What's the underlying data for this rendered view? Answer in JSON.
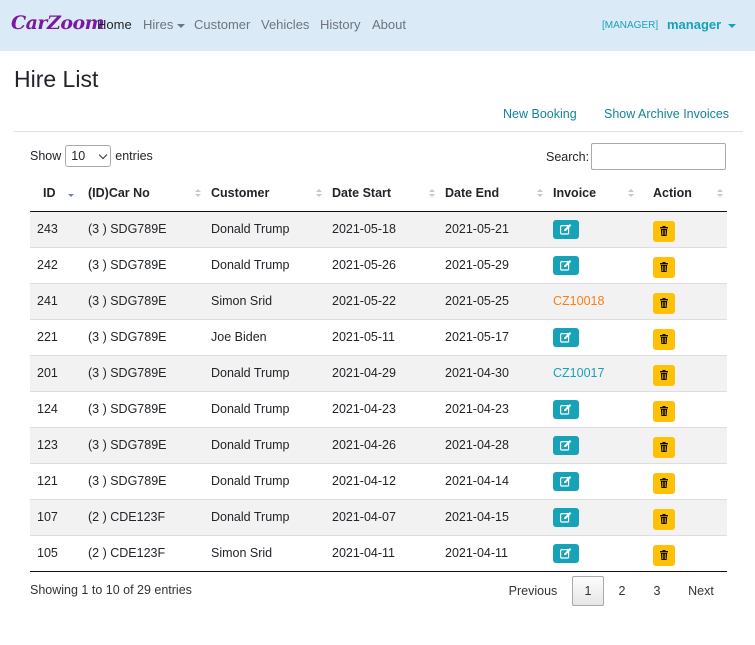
{
  "nav": {
    "brand": "CarZoom",
    "links": [
      {
        "label": "Home",
        "active": true
      },
      {
        "label": "Hires",
        "dropdown": true
      },
      {
        "label": "Customer"
      },
      {
        "label": "Vehicles"
      },
      {
        "label": "History"
      },
      {
        "label": "About"
      }
    ],
    "role": "[MANAGER]",
    "user": "manager"
  },
  "page": {
    "title": "Hire List",
    "new_booking": "New Booking",
    "show_archive": "Show Archive Invoices"
  },
  "controls": {
    "show_label": "Show",
    "entries_value": "10",
    "entries_label": "entries",
    "search_label": "Search:",
    "search_value": ""
  },
  "table": {
    "columns": [
      "ID",
      "(ID)Car No",
      "Customer",
      "Date Start",
      "Date End",
      "Invoice",
      "Action"
    ],
    "sorted_column": "ID",
    "sort_direction": "desc",
    "rows": [
      {
        "id": "243",
        "car": "(3 ) SDG789E",
        "customer": "Donald Trump",
        "start": "2021-05-18",
        "end": "2021-05-21",
        "invoice": {
          "type": "edit-button"
        }
      },
      {
        "id": "242",
        "car": "(3 ) SDG789E",
        "customer": "Donald Trump",
        "start": "2021-05-26",
        "end": "2021-05-29",
        "invoice": {
          "type": "edit-button"
        }
      },
      {
        "id": "241",
        "car": "(3 ) SDG789E",
        "customer": "Simon Srid",
        "start": "2021-05-22",
        "end": "2021-05-25",
        "invoice": {
          "type": "link",
          "text": "CZ10018",
          "color": "#fd7e14"
        }
      },
      {
        "id": "221",
        "car": "(3 ) SDG789E",
        "customer": "Joe Biden",
        "start": "2021-05-11",
        "end": "2021-05-17",
        "invoice": {
          "type": "edit-button"
        }
      },
      {
        "id": "201",
        "car": "(3 ) SDG789E",
        "customer": "Donald Trump",
        "start": "2021-04-29",
        "end": "2021-04-30",
        "invoice": {
          "type": "link",
          "text": "CZ10017",
          "color": "#17a2b8"
        }
      },
      {
        "id": "124",
        "car": "(3 ) SDG789E",
        "customer": "Donald Trump",
        "start": "2021-04-23",
        "end": "2021-04-23",
        "invoice": {
          "type": "edit-button"
        }
      },
      {
        "id": "123",
        "car": "(3 ) SDG789E",
        "customer": "Donald Trump",
        "start": "2021-04-26",
        "end": "2021-04-28",
        "invoice": {
          "type": "edit-button"
        }
      },
      {
        "id": "121",
        "car": "(3 ) SDG789E",
        "customer": "Donald Trump",
        "start": "2021-04-12",
        "end": "2021-04-14",
        "invoice": {
          "type": "edit-button"
        }
      },
      {
        "id": "107",
        "car": "(2 ) CDE123F",
        "customer": "Donald Trump",
        "start": "2021-04-07",
        "end": "2021-04-15",
        "invoice": {
          "type": "edit-button"
        }
      },
      {
        "id": "105",
        "car": "(2 ) CDE123F",
        "customer": "Simon Srid",
        "start": "2021-04-11",
        "end": "2021-04-11",
        "invoice": {
          "type": "edit-button"
        }
      }
    ]
  },
  "footer": {
    "info": "Showing 1 to 10 of 29 entries",
    "previous": "Previous",
    "pages": [
      "1",
      "2",
      "3"
    ],
    "current_page": "1",
    "next": "Next"
  },
  "colors": {
    "navbar_bg": "#dbeaf7",
    "brand": "#7a1aa0",
    "info": "#17a2b8",
    "warning": "#ffc107",
    "orange": "#fd7e14"
  }
}
